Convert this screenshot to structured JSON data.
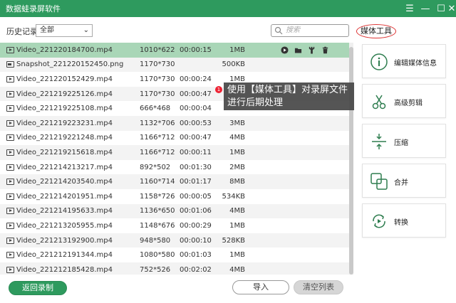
{
  "app": {
    "title": "数据蛙录屏软件"
  },
  "window_controls": {
    "menu": "☰",
    "minimize": "—",
    "maximize": "☐",
    "close": "✕"
  },
  "toolbar": {
    "history_label": "历史记录",
    "filter_value": "全部",
    "search_placeholder": "搜索"
  },
  "media_tools_heading": "媒体工具",
  "files": [
    {
      "name": "Video_221220184700.mp4",
      "resolution": "1010*622",
      "duration": "00:00:15",
      "size": "1MB",
      "type": "video",
      "selected": true
    },
    {
      "name": "Snapshot_221220152450.png",
      "resolution": "1170*730",
      "duration": "",
      "size": "500KB",
      "type": "image"
    },
    {
      "name": "Video_221220152429.mp4",
      "resolution": "1170*730",
      "duration": "00:00:24",
      "size": "1MB",
      "type": "video"
    },
    {
      "name": "Video_221219225126.mp4",
      "resolution": "1170*730",
      "duration": "00:00:47",
      "size": "",
      "type": "video"
    },
    {
      "name": "Video_221219225108.mp4",
      "resolution": "666*468",
      "duration": "00:00:04",
      "size": "",
      "type": "video"
    },
    {
      "name": "Video_221219223231.mp4",
      "resolution": "1132*706",
      "duration": "00:00:53",
      "size": "3MB",
      "type": "video"
    },
    {
      "name": "Video_221219221248.mp4",
      "resolution": "1166*712",
      "duration": "00:00:47",
      "size": "4MB",
      "type": "video"
    },
    {
      "name": "Video_221219215618.mp4",
      "resolution": "1166*712",
      "duration": "00:00:11",
      "size": "1MB",
      "type": "video"
    },
    {
      "name": "Video_221214213217.mp4",
      "resolution": "892*502",
      "duration": "00:01:30",
      "size": "2MB",
      "type": "video"
    },
    {
      "name": "Video_221214203540.mp4",
      "resolution": "1160*714",
      "duration": "00:01:17",
      "size": "8MB",
      "type": "video"
    },
    {
      "name": "Video_221214201951.mp4",
      "resolution": "1158*726",
      "duration": "00:00:05",
      "size": "534KB",
      "type": "video"
    },
    {
      "name": "Video_221214195633.mp4",
      "resolution": "1136*650",
      "duration": "00:01:06",
      "size": "4MB",
      "type": "video"
    },
    {
      "name": "Video_221213205955.mp4",
      "resolution": "1148*676",
      "duration": "00:00:29",
      "size": "1MB",
      "type": "video"
    },
    {
      "name": "Video_221213192900.mp4",
      "resolution": "948*580",
      "duration": "00:00:10",
      "size": "528KB",
      "type": "video"
    },
    {
      "name": "Video_221212191344.mp4",
      "resolution": "1080*580",
      "duration": "00:01:03",
      "size": "1MB",
      "type": "video"
    },
    {
      "name": "Video_221212185428.mp4",
      "resolution": "752*526",
      "duration": "00:02:02",
      "size": "4MB",
      "type": "video"
    }
  ],
  "tooltip": {
    "badge": "1",
    "text": "使用【媒体工具】对录屏文件进行后期处理"
  },
  "tools": [
    {
      "label": "编辑媒体信息",
      "icon": "info-icon"
    },
    {
      "label": "高级剪辑",
      "icon": "scissors-icon"
    },
    {
      "label": "压缩",
      "icon": "compress-icon"
    },
    {
      "label": "合并",
      "icon": "merge-icon"
    },
    {
      "label": "转换",
      "icon": "convert-icon"
    }
  ],
  "footer": {
    "back_label": "返回录制",
    "import_label": "导入",
    "clear_label": "清空列表"
  },
  "colors": {
    "accent": "#2e9a5e",
    "selected_row": "#a9d6b7",
    "highlight_ring": "#dd3333"
  }
}
